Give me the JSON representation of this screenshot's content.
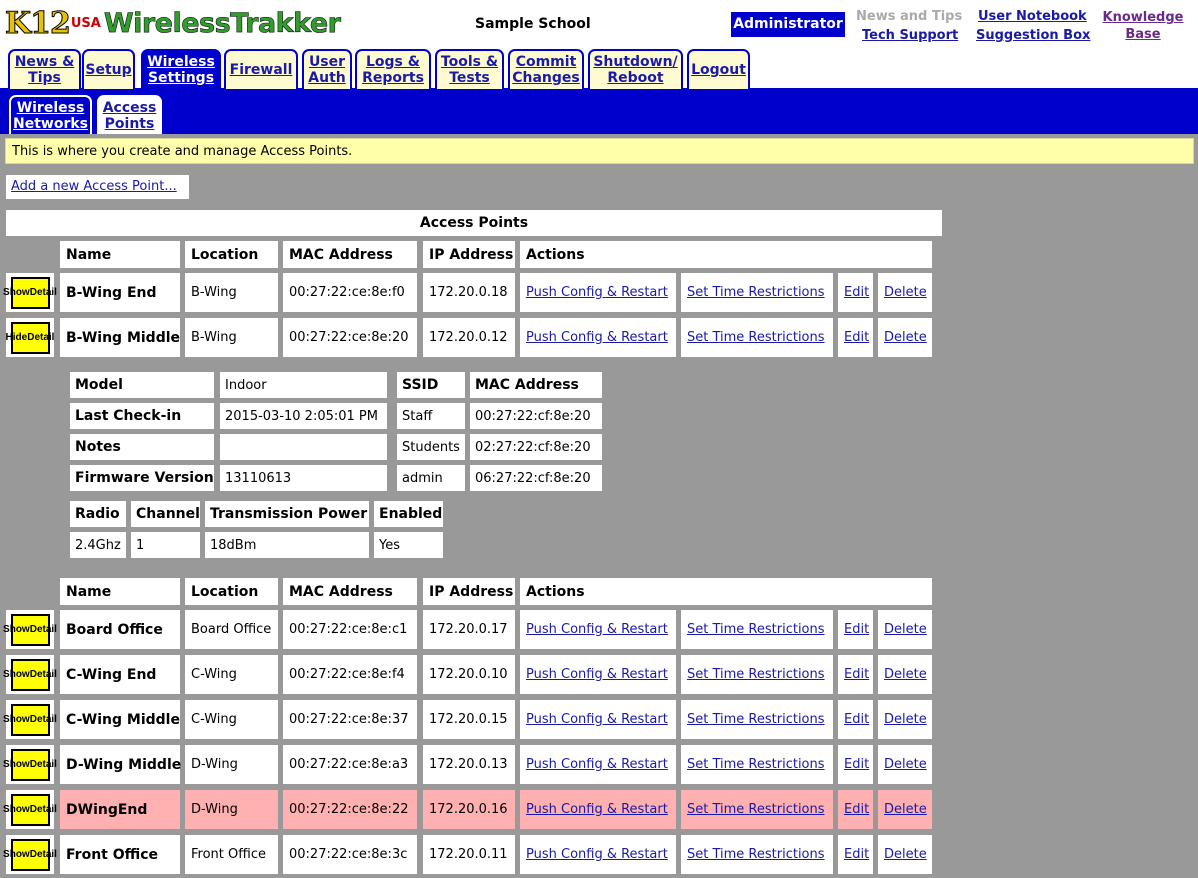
{
  "header": {
    "logo_main": "K12",
    "logo_small": "USA",
    "logo_product": "WirelessTrakker",
    "school": "Sample School",
    "role": "Administrator",
    "links": {
      "news_tips": "News and Tips",
      "tech_support": "Tech Support",
      "user_notebook": "User Notebook",
      "suggestion_box": "Suggestion Box",
      "knowledge_base_1": "Knowledge",
      "knowledge_base_2": "Base"
    }
  },
  "tabs": [
    {
      "l1": "News &",
      "l2": "Tips"
    },
    {
      "l1": "Setup",
      "l2": ""
    },
    {
      "l1": "Wireless",
      "l2": "Settings"
    },
    {
      "l1": "Firewall",
      "l2": ""
    },
    {
      "l1": "User",
      "l2": "Auth"
    },
    {
      "l1": "Logs &",
      "l2": "Reports"
    },
    {
      "l1": "Tools &",
      "l2": "Tests"
    },
    {
      "l1": "Commit",
      "l2": "Changes"
    },
    {
      "l1": "Shutdown/",
      "l2": "Reboot"
    },
    {
      "l1": "Logout",
      "l2": ""
    }
  ],
  "subtabs": [
    {
      "l1": "Wireless",
      "l2": "Networks"
    },
    {
      "l1": "Access",
      "l2": "Points"
    }
  ],
  "info": "This is where you create and manage Access Points.",
  "add_link": "Add a new Access Point...",
  "table_title": "Access Points",
  "columns": {
    "name": "Name",
    "location": "Location",
    "mac": "MAC Address",
    "ip": "IP Address",
    "actions": "Actions"
  },
  "actions": {
    "push": "Push Config & Restart",
    "time": "Set Time Restrictions",
    "edit": "Edit",
    "delete": "Delete"
  },
  "buttons": {
    "show_1": "Show",
    "show_2": "Detail",
    "hide_1": "Hide",
    "hide_2": "Detail"
  },
  "group1": [
    {
      "name": "B-Wing End",
      "location": "B-Wing",
      "mac": "00:27:22:ce:8e:f0",
      "ip": "172.20.0.18"
    },
    {
      "name": "B-Wing Middle",
      "location": "B-Wing",
      "mac": "00:27:22:ce:8e:20",
      "ip": "172.20.0.12"
    }
  ],
  "detail": {
    "model_label": "Model",
    "model": "Indoor",
    "checkin_label": "Last Check-in",
    "checkin": "2015-03-10 2:05:01 PM",
    "notes_label": "Notes",
    "notes": "",
    "firmware_label": "Firmware Version",
    "firmware": "13110613",
    "ssid_label": "SSID",
    "ssid_mac_label": "MAC Address",
    "ssids": [
      {
        "ssid": "Staff",
        "mac": "00:27:22:cf:8e:20"
      },
      {
        "ssid": "Students",
        "mac": "02:27:22:cf:8e:20"
      },
      {
        "ssid": "admin",
        "mac": "06:27:22:cf:8e:20"
      }
    ],
    "radio_label": "Radio",
    "channel_label": "Channel",
    "power_label": "Transmission Power",
    "enabled_label": "Enabled",
    "radio": "2.4Ghz",
    "channel": "1",
    "power": "18dBm",
    "enabled": "Yes"
  },
  "group2": [
    {
      "name": "Board Office",
      "location": "Board Office",
      "mac": "00:27:22:ce:8e:c1",
      "ip": "172.20.0.17"
    },
    {
      "name": "C-Wing End",
      "location": "C-Wing",
      "mac": "00:27:22:ce:8e:f4",
      "ip": "172.20.0.10"
    },
    {
      "name": "C-Wing Middle",
      "location": "C-Wing",
      "mac": "00:27:22:ce:8e:37",
      "ip": "172.20.0.15"
    },
    {
      "name": "D-Wing Middle",
      "location": "D-Wing",
      "mac": "00:27:22:ce:8e:a3",
      "ip": "172.20.0.13"
    },
    {
      "name": "DWingEnd",
      "location": "D-Wing",
      "mac": "00:27:22:ce:8e:22",
      "ip": "172.20.0.16"
    },
    {
      "name": "Front Office",
      "location": "Front Office",
      "mac": "00:27:22:ce:8e:3c",
      "ip": "172.20.0.11"
    }
  ],
  "colors": {
    "warning_row": "#ffb0b0",
    "brand_blue": "#0000cc",
    "button_yellow": "#ffff00"
  }
}
